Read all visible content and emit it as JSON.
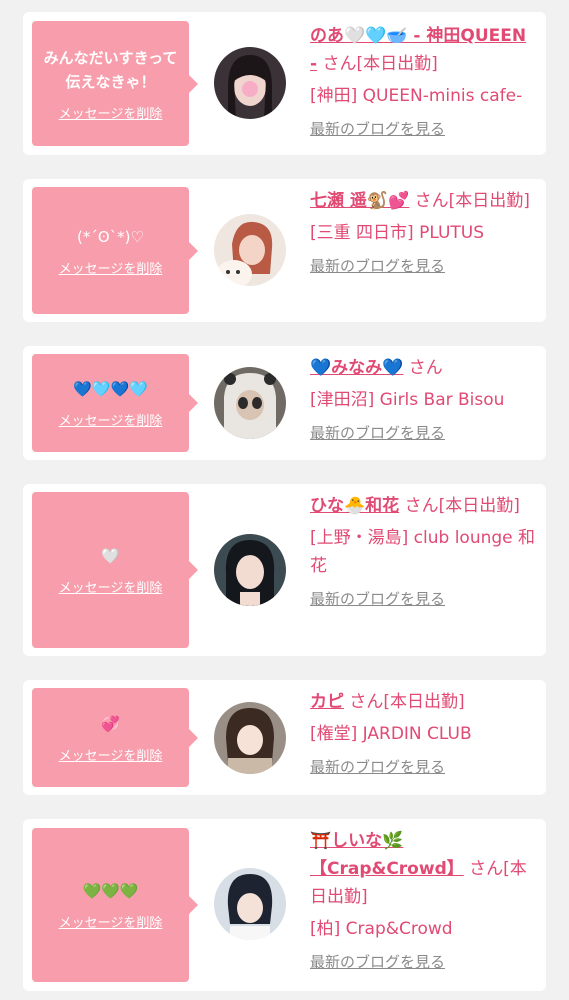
{
  "common": {
    "delete_label": "メッセージを削除",
    "blog_label": "最新のブログを見る",
    "san": "さん"
  },
  "cards": [
    {
      "message": "みんなだいすきって伝えなきゃ！",
      "name": "のあ🤍🩵🥣 - 神田QUEEN -",
      "status": "[本日出勤]",
      "shop": "[神田] QUEEN-minis cafe-",
      "avatar_icon": "girl-photo-1"
    },
    {
      "message": "(*´ʘ`*)♡",
      "name": "七瀬 遥🐒💕",
      "status": "[本日出勤]",
      "shop": "[三重 四日市] PLUTUS",
      "avatar_icon": "girl-photo-2"
    },
    {
      "message": "💙🩵💙🩵",
      "name": "💙みなみ💙",
      "status": "",
      "shop": "[津田沼] Girls Bar Bisou",
      "avatar_icon": "girl-photo-3"
    },
    {
      "message": "🤍",
      "name": "ひな🐣和花",
      "status": "[本日出勤]",
      "shop": "[上野・湯島] club lounge 和花",
      "avatar_icon": "girl-photo-4"
    },
    {
      "message": "💞",
      "name": "カピ",
      "status": "[本日出勤]",
      "shop": "[権堂] JARDIN CLUB",
      "avatar_icon": "girl-photo-5"
    },
    {
      "message": "💚💚💚",
      "name": "⛩️しいな🌿【Crap&Crowd】",
      "status": "[本日出勤]",
      "shop": "[柏] Crap&Crowd",
      "avatar_icon": "girl-photo-6"
    }
  ],
  "colors": {
    "accent": "#e04a73",
    "bubble": "#f79dab",
    "muted": "#8a8a8a",
    "background": "#f1f1f1"
  }
}
